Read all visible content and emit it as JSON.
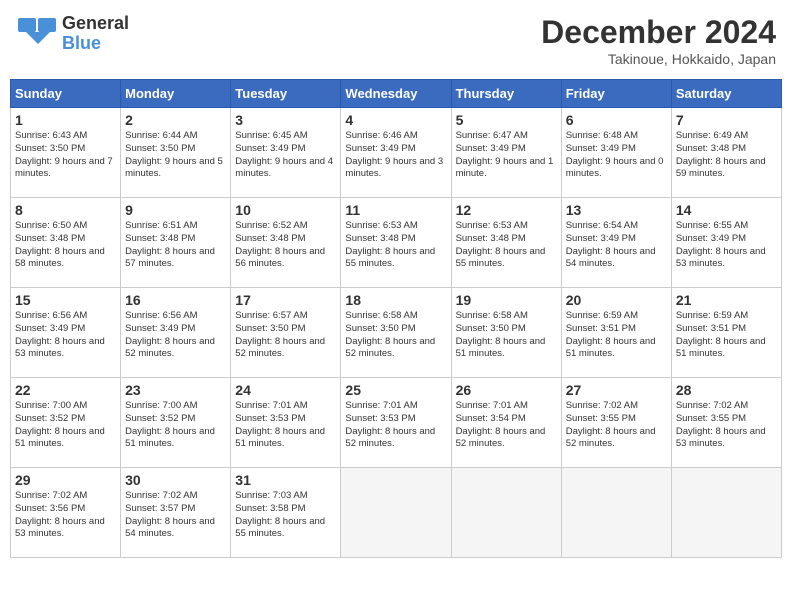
{
  "header": {
    "logo_line1": "General",
    "logo_line2": "Blue",
    "month": "December 2024",
    "location": "Takinoue, Hokkaido, Japan"
  },
  "weekdays": [
    "Sunday",
    "Monday",
    "Tuesday",
    "Wednesday",
    "Thursday",
    "Friday",
    "Saturday"
  ],
  "weeks": [
    [
      {
        "day": "1",
        "sunrise": "Sunrise: 6:43 AM",
        "sunset": "Sunset: 3:50 PM",
        "daylight": "Daylight: 9 hours and 7 minutes."
      },
      {
        "day": "2",
        "sunrise": "Sunrise: 6:44 AM",
        "sunset": "Sunset: 3:50 PM",
        "daylight": "Daylight: 9 hours and 5 minutes."
      },
      {
        "day": "3",
        "sunrise": "Sunrise: 6:45 AM",
        "sunset": "Sunset: 3:49 PM",
        "daylight": "Daylight: 9 hours and 4 minutes."
      },
      {
        "day": "4",
        "sunrise": "Sunrise: 6:46 AM",
        "sunset": "Sunset: 3:49 PM",
        "daylight": "Daylight: 9 hours and 3 minutes."
      },
      {
        "day": "5",
        "sunrise": "Sunrise: 6:47 AM",
        "sunset": "Sunset: 3:49 PM",
        "daylight": "Daylight: 9 hours and 1 minute."
      },
      {
        "day": "6",
        "sunrise": "Sunrise: 6:48 AM",
        "sunset": "Sunset: 3:49 PM",
        "daylight": "Daylight: 9 hours and 0 minutes."
      },
      {
        "day": "7",
        "sunrise": "Sunrise: 6:49 AM",
        "sunset": "Sunset: 3:48 PM",
        "daylight": "Daylight: 8 hours and 59 minutes."
      }
    ],
    [
      {
        "day": "8",
        "sunrise": "Sunrise: 6:50 AM",
        "sunset": "Sunset: 3:48 PM",
        "daylight": "Daylight: 8 hours and 58 minutes."
      },
      {
        "day": "9",
        "sunrise": "Sunrise: 6:51 AM",
        "sunset": "Sunset: 3:48 PM",
        "daylight": "Daylight: 8 hours and 57 minutes."
      },
      {
        "day": "10",
        "sunrise": "Sunrise: 6:52 AM",
        "sunset": "Sunset: 3:48 PM",
        "daylight": "Daylight: 8 hours and 56 minutes."
      },
      {
        "day": "11",
        "sunrise": "Sunrise: 6:53 AM",
        "sunset": "Sunset: 3:48 PM",
        "daylight": "Daylight: 8 hours and 55 minutes."
      },
      {
        "day": "12",
        "sunrise": "Sunrise: 6:53 AM",
        "sunset": "Sunset: 3:48 PM",
        "daylight": "Daylight: 8 hours and 55 minutes."
      },
      {
        "day": "13",
        "sunrise": "Sunrise: 6:54 AM",
        "sunset": "Sunset: 3:49 PM",
        "daylight": "Daylight: 8 hours and 54 minutes."
      },
      {
        "day": "14",
        "sunrise": "Sunrise: 6:55 AM",
        "sunset": "Sunset: 3:49 PM",
        "daylight": "Daylight: 8 hours and 53 minutes."
      }
    ],
    [
      {
        "day": "15",
        "sunrise": "Sunrise: 6:56 AM",
        "sunset": "Sunset: 3:49 PM",
        "daylight": "Daylight: 8 hours and 53 minutes."
      },
      {
        "day": "16",
        "sunrise": "Sunrise: 6:56 AM",
        "sunset": "Sunset: 3:49 PM",
        "daylight": "Daylight: 8 hours and 52 minutes."
      },
      {
        "day": "17",
        "sunrise": "Sunrise: 6:57 AM",
        "sunset": "Sunset: 3:50 PM",
        "daylight": "Daylight: 8 hours and 52 minutes."
      },
      {
        "day": "18",
        "sunrise": "Sunrise: 6:58 AM",
        "sunset": "Sunset: 3:50 PM",
        "daylight": "Daylight: 8 hours and 52 minutes."
      },
      {
        "day": "19",
        "sunrise": "Sunrise: 6:58 AM",
        "sunset": "Sunset: 3:50 PM",
        "daylight": "Daylight: 8 hours and 51 minutes."
      },
      {
        "day": "20",
        "sunrise": "Sunrise: 6:59 AM",
        "sunset": "Sunset: 3:51 PM",
        "daylight": "Daylight: 8 hours and 51 minutes."
      },
      {
        "day": "21",
        "sunrise": "Sunrise: 6:59 AM",
        "sunset": "Sunset: 3:51 PM",
        "daylight": "Daylight: 8 hours and 51 minutes."
      }
    ],
    [
      {
        "day": "22",
        "sunrise": "Sunrise: 7:00 AM",
        "sunset": "Sunset: 3:52 PM",
        "daylight": "Daylight: 8 hours and 51 minutes."
      },
      {
        "day": "23",
        "sunrise": "Sunrise: 7:00 AM",
        "sunset": "Sunset: 3:52 PM",
        "daylight": "Daylight: 8 hours and 51 minutes."
      },
      {
        "day": "24",
        "sunrise": "Sunrise: 7:01 AM",
        "sunset": "Sunset: 3:53 PM",
        "daylight": "Daylight: 8 hours and 51 minutes."
      },
      {
        "day": "25",
        "sunrise": "Sunrise: 7:01 AM",
        "sunset": "Sunset: 3:53 PM",
        "daylight": "Daylight: 8 hours and 52 minutes."
      },
      {
        "day": "26",
        "sunrise": "Sunrise: 7:01 AM",
        "sunset": "Sunset: 3:54 PM",
        "daylight": "Daylight: 8 hours and 52 minutes."
      },
      {
        "day": "27",
        "sunrise": "Sunrise: 7:02 AM",
        "sunset": "Sunset: 3:55 PM",
        "daylight": "Daylight: 8 hours and 52 minutes."
      },
      {
        "day": "28",
        "sunrise": "Sunrise: 7:02 AM",
        "sunset": "Sunset: 3:55 PM",
        "daylight": "Daylight: 8 hours and 53 minutes."
      }
    ],
    [
      {
        "day": "29",
        "sunrise": "Sunrise: 7:02 AM",
        "sunset": "Sunset: 3:56 PM",
        "daylight": "Daylight: 8 hours and 53 minutes."
      },
      {
        "day": "30",
        "sunrise": "Sunrise: 7:02 AM",
        "sunset": "Sunset: 3:57 PM",
        "daylight": "Daylight: 8 hours and 54 minutes."
      },
      {
        "day": "31",
        "sunrise": "Sunrise: 7:03 AM",
        "sunset": "Sunset: 3:58 PM",
        "daylight": "Daylight: 8 hours and 55 minutes."
      },
      null,
      null,
      null,
      null
    ]
  ]
}
